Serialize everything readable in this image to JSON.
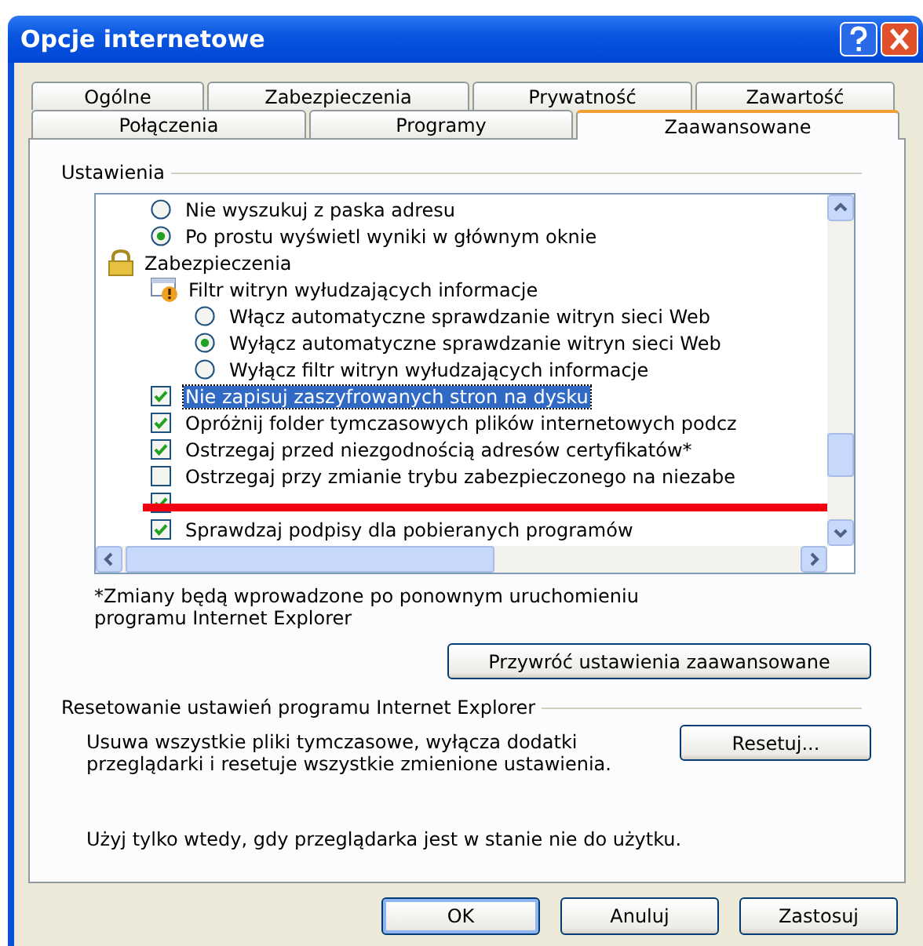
{
  "window": {
    "title": "Opcje internetowe"
  },
  "tab_rows": [
    [
      {
        "label": "Ogólne",
        "selected": false
      },
      {
        "label": "Zabezpieczenia",
        "selected": false
      },
      {
        "label": "Prywatność",
        "selected": false
      },
      {
        "label": "Zawartość",
        "selected": false
      }
    ],
    [
      {
        "label": "Połączenia",
        "selected": false
      },
      {
        "label": "Programy",
        "selected": false
      },
      {
        "label": "Zaawansowane",
        "selected": true
      }
    ]
  ],
  "settings": {
    "title": "Ustawienia",
    "items": [
      {
        "kind": "radio",
        "label": "Nie wyszukuj z paska adresu",
        "checked": false,
        "selected": false
      },
      {
        "kind": "radio",
        "label": "Po prostu wyświetl wyniki w głównym oknie",
        "checked": true,
        "selected": false
      },
      {
        "kind": "group",
        "label": "Zabezpieczenia",
        "children": [
          {
            "kind": "group",
            "label": "Filtr witryn wyłudzających informacje",
            "children": [
              {
                "kind": "radio",
                "label": "Włącz automatyczne sprawdzanie witryn sieci Web",
                "checked": false,
                "selected": false
              },
              {
                "kind": "radio",
                "label": "Wyłącz automatyczne sprawdzanie witryn sieci Web",
                "checked": true,
                "selected": false
              },
              {
                "kind": "radio",
                "label": "Wyłącz filtr witryn wyłudzających informacje",
                "checked": false,
                "selected": false
              }
            ]
          },
          {
            "kind": "checkbox",
            "label": "Nie zapisuj zaszyfrowanych stron na dysku",
            "checked": true,
            "selected": true
          },
          {
            "kind": "checkbox",
            "label": "Opróżnij folder tymczasowych plików internetowych podcz",
            "checked": true,
            "selected": false
          },
          {
            "kind": "checkbox",
            "label": "Ostrzegaj przed niezgodnością adresów certyfikatów*",
            "checked": true,
            "selected": false
          },
          {
            "kind": "checkbox",
            "label": "Ostrzegaj przy zmianie trybu zabezpieczonego na niezabe",
            "checked": false,
            "selected": false
          },
          {
            "kind": "checkbox",
            "checked": true,
            "struck": true
          },
          {
            "kind": "checkbox",
            "label": "Sprawdzaj podpisy dla pobieranych programów",
            "checked": true,
            "selected": false
          }
        ]
      }
    ]
  },
  "note": "*Zmiany będą wprowadzone po ponownym uruchomieniu programu Internet Explorer",
  "restore_button": "Przywróć ustawienia zaawansowane",
  "reset": {
    "title": "Resetowanie ustawień programu Internet Explorer",
    "description": "Usuwa wszystkie pliki tymczasowe, wyłącza dodatki przeglądarki i resetuje wszystkie zmienione ustawienia.",
    "button": "Resetuj...",
    "hint": "Użyj tylko wtedy, gdy przeglądarka jest w stanie nie do użytku."
  },
  "buttons": [
    {
      "label": "OK",
      "default": true
    },
    {
      "label": "Anuluj",
      "default": false
    },
    {
      "label": "Zastosuj",
      "default": false
    }
  ]
}
